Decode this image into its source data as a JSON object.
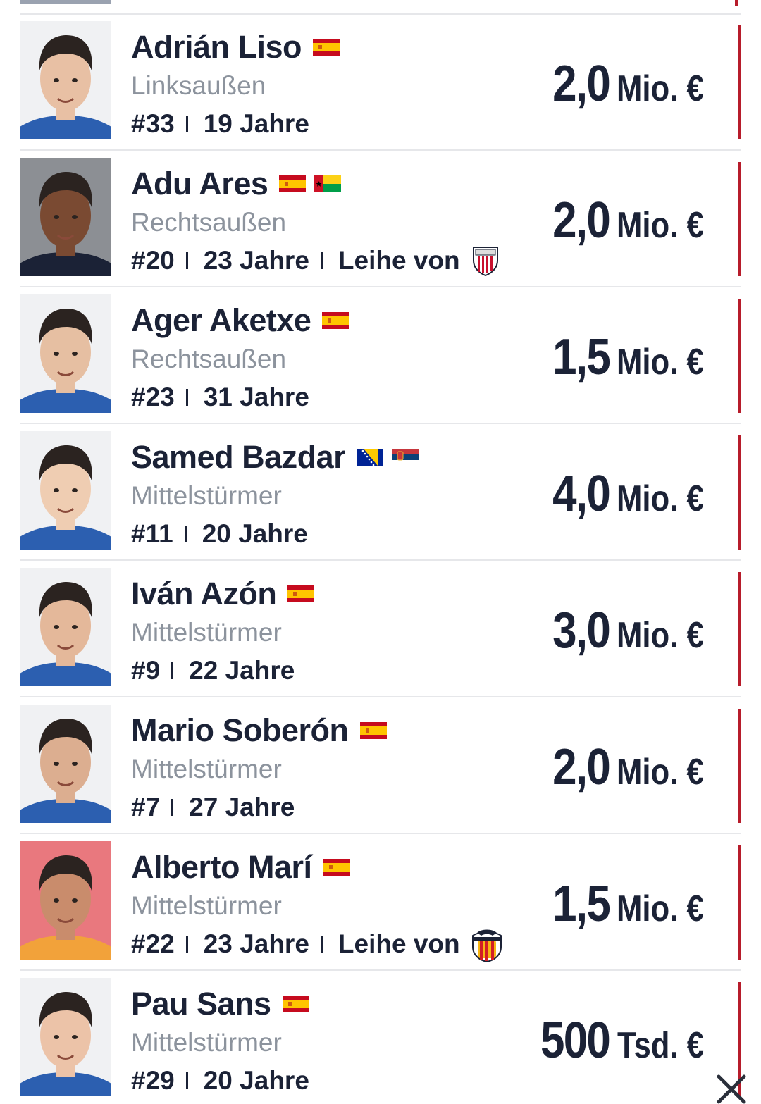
{
  "colors": {
    "text_primary": "#1b2236",
    "text_secondary": "#8c939d",
    "accent": "#b71c2b",
    "divider": "#e6e7ea"
  },
  "players": [
    {
      "name": "Adrián Liso",
      "flags": [
        "spain-flag"
      ],
      "position": "Linksaußen",
      "number": "#33",
      "age": "19 Jahre",
      "loan_text": "",
      "loan_crest": "",
      "value_amount": "2,0",
      "value_unit": "Mio. €"
    },
    {
      "name": "Adu Ares",
      "flags": [
        "spain-flag",
        "guinea-bissau-flag"
      ],
      "position": "Rechtsaußen",
      "number": "#20",
      "age": "23 Jahre",
      "loan_text": "Leihe von",
      "loan_crest": "athletic-bilbao-crest-icon",
      "value_amount": "2,0",
      "value_unit": "Mio. €"
    },
    {
      "name": "Ager Aketxe",
      "flags": [
        "spain-flag"
      ],
      "position": "Rechtsaußen",
      "number": "#23",
      "age": "31 Jahre",
      "loan_text": "",
      "loan_crest": "",
      "value_amount": "1,5",
      "value_unit": "Mio. €"
    },
    {
      "name": "Samed Bazdar",
      "flags": [
        "bosnia-flag",
        "serbia-flag"
      ],
      "position": "Mittelstürmer",
      "number": "#11",
      "age": "20 Jahre",
      "loan_text": "",
      "loan_crest": "",
      "value_amount": "4,0",
      "value_unit": "Mio. €"
    },
    {
      "name": "Iván Azón",
      "flags": [
        "spain-flag"
      ],
      "position": "Mittelstürmer",
      "number": "#9",
      "age": "22 Jahre",
      "loan_text": "",
      "loan_crest": "",
      "value_amount": "3,0",
      "value_unit": "Mio. €"
    },
    {
      "name": "Mario Soberón",
      "flags": [
        "spain-flag"
      ],
      "position": "Mittelstürmer",
      "number": "#7",
      "age": "27 Jahre",
      "loan_text": "",
      "loan_crest": "",
      "value_amount": "2,0",
      "value_unit": "Mio. €"
    },
    {
      "name": "Alberto Marí",
      "flags": [
        "spain-flag"
      ],
      "position": "Mittelstürmer",
      "number": "#22",
      "age": "23 Jahre",
      "loan_text": "Leihe von",
      "loan_crest": "valencia-crest-icon",
      "value_amount": "1,5",
      "value_unit": "Mio. €"
    },
    {
      "name": "Pau Sans",
      "flags": [
        "spain-flag"
      ],
      "position": "Mittelstürmer",
      "number": "#29",
      "age": "20 Jahre",
      "loan_text": "",
      "loan_crest": "",
      "value_amount": "500",
      "value_unit": "Tsd. €"
    }
  ],
  "overlay": {
    "close_icon": "close-icon"
  }
}
